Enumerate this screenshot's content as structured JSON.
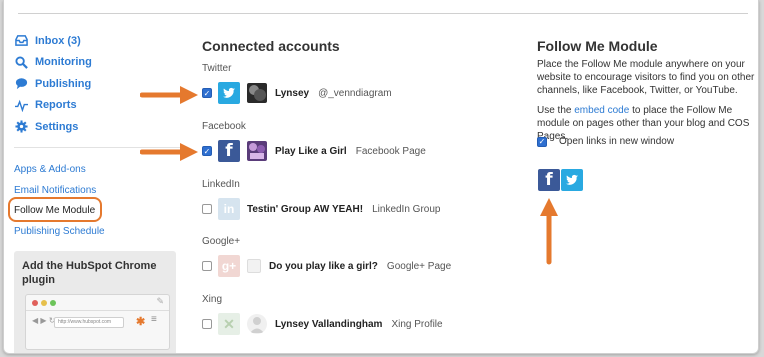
{
  "sidebar": {
    "nav": [
      {
        "label": "Inbox (3)",
        "icon": "inbox-icon"
      },
      {
        "label": "Monitoring",
        "icon": "search-icon"
      },
      {
        "label": "Publishing",
        "icon": "speech-bubble-icon"
      },
      {
        "label": "Reports",
        "icon": "pulse-icon"
      },
      {
        "label": "Settings",
        "icon": "gear-icon"
      }
    ],
    "links": [
      {
        "label": "Apps & Add-ons"
      },
      {
        "label": "Email Notifications"
      },
      {
        "label": "Follow Me Module",
        "active": true
      },
      {
        "label": "Publishing Schedule"
      }
    ],
    "chrome_card": {
      "title": "Add the HubSpot Chrome plugin",
      "url": "http://www.hubspot.com"
    }
  },
  "connected": {
    "title": "Connected accounts",
    "groups": [
      {
        "network": "Twitter",
        "name": "Lynsey",
        "type": "@_venndiagram",
        "checked": true,
        "icon": "twitter-icon",
        "color": "#29a9e1"
      },
      {
        "network": "Facebook",
        "name": "Play Like a Girl",
        "type": "Facebook Page",
        "checked": true,
        "icon": "facebook-icon",
        "color": "#3b5998"
      },
      {
        "network": "LinkedIn",
        "name": "Testin' Group AW YEAH!",
        "type": "LinkedIn Group",
        "checked": false,
        "icon": "linkedin-icon",
        "color": "#d6e4ef"
      },
      {
        "network": "Google+",
        "name": "Do you play like a girl?",
        "type": "Google+ Page",
        "checked": false,
        "icon": "google-plus-icon",
        "color": "#f1d7d3"
      },
      {
        "network": "Xing",
        "name": "Lynsey Vallandingham",
        "type": "Xing Profile",
        "checked": false,
        "icon": "xing-icon",
        "color": "#e6efe6"
      }
    ]
  },
  "follow_me": {
    "title": "Follow Me Module",
    "description": "Place the Follow Me module anywhere on your website to encourage visitors to find you on other channels, like Facebook, Twitter, or YouTube.",
    "embed_prefix": "Use the ",
    "embed_link": "embed code",
    "embed_suffix": " to place the Follow Me module on pages other than your blog and COS Pages.",
    "option_label": "Open links in new window",
    "option_checked": true
  },
  "colors": {
    "accent": "#2d7bd3",
    "arrow": "#e5792e"
  }
}
